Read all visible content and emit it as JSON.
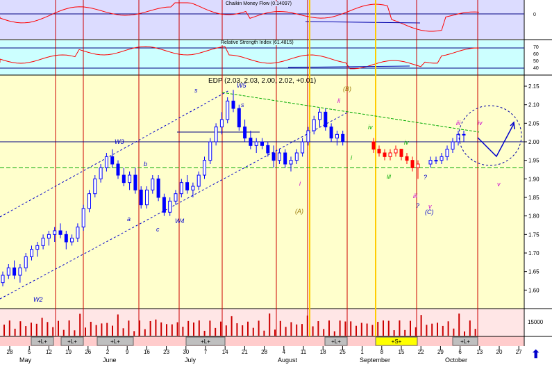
{
  "chart_data": {
    "type": "candlestick",
    "title": "EDP (2.03, 2.03, 2.00, 2.02, +0.01)",
    "ohlc": {
      "open": 2.03,
      "high": 2.03,
      "low": 2.0,
      "close": 2.02,
      "change": "+0.01"
    },
    "indicators": {
      "cmf": {
        "label": "Chaikin Money Flow (0.14097)",
        "ticks": [
          "0"
        ]
      },
      "rsi": {
        "label": "Relative Strength Index (61.4815)",
        "ticks": [
          "70",
          "60",
          "50",
          "40"
        ]
      }
    },
    "y_axis": {
      "ylim": [
        1.55,
        2.18
      ],
      "ticks": [
        2.15,
        2.1,
        2.05,
        2.0,
        1.95,
        1.9,
        1.85,
        1.8,
        1.75,
        1.7,
        1.65,
        1.6
      ]
    },
    "volume_tick": "15000",
    "x_day_labels": [
      "28",
      "5",
      "12",
      "19",
      "26",
      "2",
      "9",
      "16",
      "23",
      "30",
      "7",
      "14",
      "21",
      "28",
      "4",
      "11",
      "18",
      "25",
      "1",
      "8",
      "15",
      "22",
      "29",
      "6",
      "13",
      "20",
      "27"
    ],
    "months": [
      "May",
      "June",
      "July",
      "August",
      "September",
      "October"
    ],
    "signal_labels": [
      "+L+",
      "+L+",
      "+L+",
      "+L+",
      "+L+",
      "+S+",
      "+L+"
    ],
    "wave_labels": [
      "W2",
      "W3",
      "W4",
      "W5",
      "a",
      "b",
      "c",
      "s",
      "s",
      "(B)",
      "ii",
      "i",
      "i",
      "iii",
      "iv",
      "iii",
      "iv",
      "v",
      "?",
      "?",
      "(A)",
      "(C)",
      "iii",
      "iv",
      "v"
    ],
    "price_series_up": [
      [
        1.62,
        1.65,
        1.61,
        1.64
      ],
      [
        1.64,
        1.67,
        1.63,
        1.66
      ],
      [
        1.66,
        1.68,
        1.63,
        1.64
      ],
      [
        1.64,
        1.67,
        1.62,
        1.66
      ],
      [
        1.66,
        1.7,
        1.65,
        1.69
      ],
      [
        1.69,
        1.72,
        1.68,
        1.71
      ],
      [
        1.71,
        1.73,
        1.69,
        1.72
      ],
      [
        1.72,
        1.75,
        1.71,
        1.74
      ],
      [
        1.74,
        1.76,
        1.72,
        1.75
      ],
      [
        1.75,
        1.77,
        1.73,
        1.76
      ],
      [
        1.76,
        1.78,
        1.74,
        1.75
      ],
      [
        1.75,
        1.76,
        1.71,
        1.73
      ],
      [
        1.73,
        1.75,
        1.72,
        1.74
      ],
      [
        1.74,
        1.78,
        1.73,
        1.77
      ],
      [
        1.77,
        1.83,
        1.76,
        1.82
      ],
      [
        1.82,
        1.87,
        1.81,
        1.86
      ],
      [
        1.86,
        1.91,
        1.85,
        1.9
      ],
      [
        1.9,
        1.94,
        1.89,
        1.93
      ],
      [
        1.93,
        1.97,
        1.92,
        1.96
      ],
      [
        1.96,
        1.98,
        1.93,
        1.94
      ],
      [
        1.94,
        1.95,
        1.9,
        1.91
      ],
      [
        1.91,
        1.93,
        1.88,
        1.89
      ],
      [
        1.89,
        1.92,
        1.87,
        1.91
      ],
      [
        1.91,
        1.93,
        1.86,
        1.87
      ],
      [
        1.87,
        1.88,
        1.82,
        1.83
      ],
      [
        1.83,
        1.88,
        1.82,
        1.87
      ],
      [
        1.87,
        1.91,
        1.86,
        1.9
      ],
      [
        1.9,
        1.91,
        1.84,
        1.85
      ],
      [
        1.85,
        1.86,
        1.8,
        1.81
      ],
      [
        1.81,
        1.85,
        1.8,
        1.84
      ],
      [
        1.84,
        1.87,
        1.83,
        1.86
      ],
      [
        1.86,
        1.9,
        1.85,
        1.89
      ],
      [
        1.89,
        1.91,
        1.86,
        1.87
      ],
      [
        1.87,
        1.89,
        1.85,
        1.88
      ],
      [
        1.88,
        1.92,
        1.87,
        1.91
      ],
      [
        1.91,
        1.96,
        1.9,
        1.95
      ],
      [
        1.95,
        2.01,
        1.94,
        2.0
      ],
      [
        2.0,
        2.05,
        1.99,
        2.04
      ],
      [
        2.04,
        2.08,
        2.02,
        2.06
      ],
      [
        2.06,
        2.12,
        2.05,
        2.11
      ],
      [
        2.11,
        2.14,
        2.08,
        2.09
      ],
      [
        2.09,
        2.1,
        2.03,
        2.04
      ],
      [
        2.04,
        2.06,
        2.0,
        2.01
      ],
      [
        2.01,
        2.03,
        1.98,
        1.99
      ],
      [
        1.99,
        2.01,
        1.97,
        2.0
      ],
      [
        2.0,
        2.01,
        1.98,
        1.99
      ],
      [
        1.99,
        2.0,
        1.96,
        1.97
      ],
      [
        1.97,
        1.99,
        1.93,
        1.95
      ],
      [
        1.95,
        1.98,
        1.94,
        1.97
      ],
      [
        1.97,
        1.98,
        1.93,
        1.94
      ],
      [
        1.94,
        1.96,
        1.92,
        1.95
      ],
      [
        1.95,
        1.98,
        1.94,
        1.97
      ],
      [
        1.97,
        2.01,
        1.96,
        2.0
      ],
      [
        2.0,
        2.04,
        1.99,
        2.03
      ],
      [
        2.03,
        2.07,
        2.02,
        2.06
      ],
      [
        2.06,
        2.09,
        2.04,
        2.08
      ],
      [
        2.08,
        2.09,
        2.03,
        2.04
      ],
      [
        2.04,
        2.05,
        2.0,
        2.01
      ],
      [
        2.01,
        2.03,
        1.99,
        2.02
      ],
      [
        2.02,
        2.03,
        1.99,
        2.0
      ]
    ],
    "price_series_down": [
      [
        2.0,
        2.01,
        1.97,
        1.98
      ],
      [
        1.98,
        1.99,
        1.96,
        1.97
      ],
      [
        1.97,
        1.98,
        1.95,
        1.96
      ],
      [
        1.96,
        1.98,
        1.95,
        1.97
      ],
      [
        1.97,
        1.99,
        1.96,
        1.98
      ],
      [
        1.98,
        1.98,
        1.95,
        1.96
      ],
      [
        1.96,
        1.97,
        1.94,
        1.95
      ],
      [
        1.95,
        1.96,
        1.92,
        1.93
      ],
      [
        1.93,
        1.95,
        1.9,
        1.94
      ]
    ],
    "price_series_final": [
      [
        1.94,
        1.96,
        1.93,
        1.95
      ],
      [
        1.95,
        1.96,
        1.94,
        1.95
      ],
      [
        1.95,
        1.97,
        1.94,
        1.96
      ],
      [
        1.96,
        1.99,
        1.95,
        1.98
      ],
      [
        1.98,
        2.01,
        1.97,
        2.0
      ],
      [
        2.0,
        2.03,
        1.99,
        2.02
      ],
      [
        2.02,
        2.03,
        2.0,
        2.02
      ]
    ],
    "colors": {
      "up_candle": "#0000ff",
      "down_candle": "#ff0000",
      "price_bg": "#ffffcc",
      "indicator_bg": "#ccffff",
      "volume_bg": "#ffe0e0",
      "signal_long": "#bfbfbf",
      "signal_short": "#ffff00",
      "channel": "#0000cc",
      "trend_green": "#00aa00"
    },
    "grid": false
  }
}
